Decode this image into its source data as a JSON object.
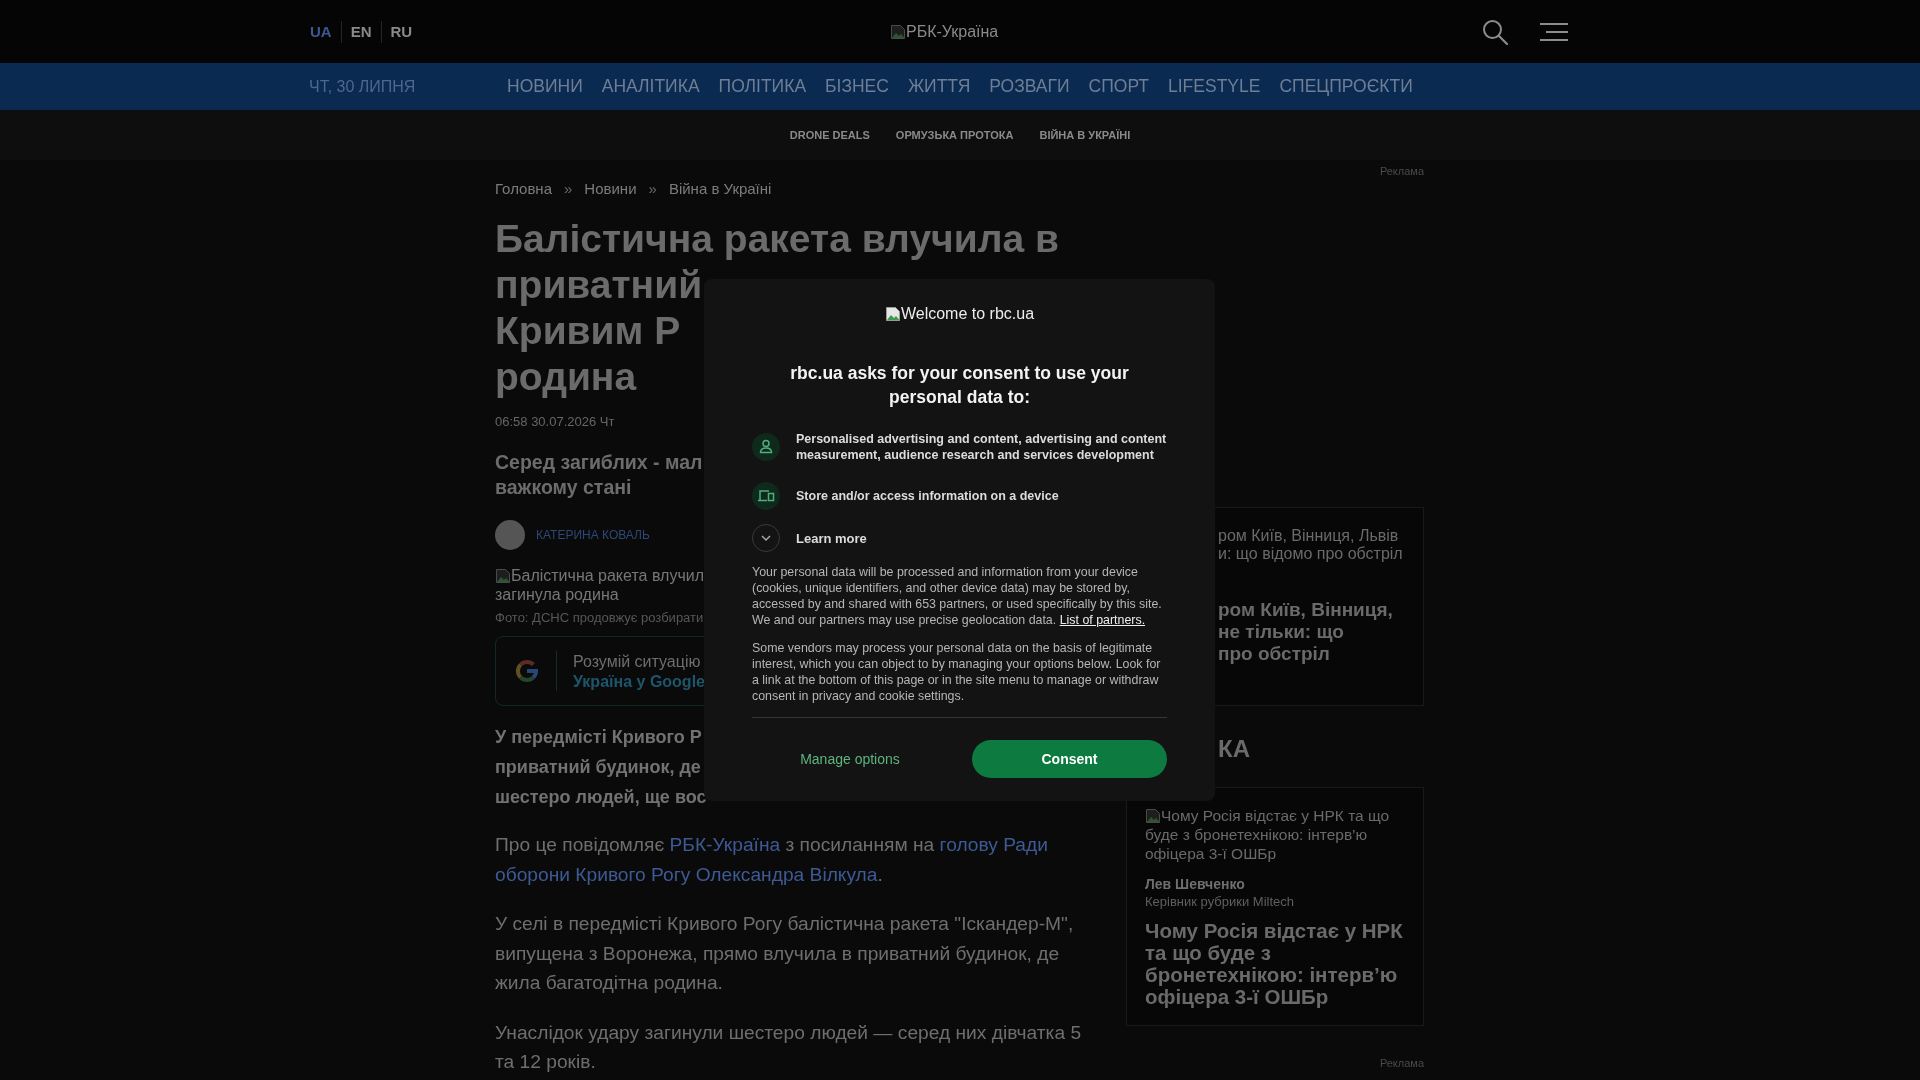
{
  "header": {
    "languages": [
      {
        "label": "UA",
        "selected": true
      },
      {
        "label": "EN",
        "selected": false
      },
      {
        "label": "RU",
        "selected": false
      }
    ],
    "logo_alt": "РБК-Україна"
  },
  "nav": {
    "date": "ЧТ, 30 ЛИПНЯ",
    "items": [
      "НОВИНИ",
      "АНАЛІТИКА",
      "ПОЛІТИКА",
      "БІЗНЕС",
      "ЖИТТЯ",
      "РОЗВАГИ",
      "СПОРТ",
      "LIFESTYLE",
      "СПЕЦПРОЄКТИ"
    ]
  },
  "tags": [
    "DRONE DEALS",
    "ОРМУЗЬКА ПРОТОКА",
    "ВІЙНА В УКРАЇНІ"
  ],
  "article": {
    "breadcrumbs": [
      {
        "kind": "link",
        "label": "Головна"
      },
      {
        "kind": "separator",
        "label": "»"
      },
      {
        "kind": "link",
        "label": "Новини"
      },
      {
        "kind": "separator",
        "label": "»"
      },
      {
        "kind": "link",
        "label": "Війна в Україні"
      }
    ],
    "title_lines": [
      "Балістична ракета влучила в",
      "приватний",
      "Кривим Р",
      "родина"
    ],
    "published": "06:58 30.07.2026 Чт",
    "lead_lines": [
      "Серед загиблих - мал",
      "важкому стані"
    ],
    "author": "КАТЕРИНА КОВАЛЬ",
    "image_alt_lines": [
      "Балістична ракета влучил",
      "загинула родина"
    ],
    "photo_caption": "Фото: ДСНС продовжує розбирати",
    "promo": {
      "text": "Розумій ситуацію",
      "link": "Україна у Google"
    },
    "intro_lines": [
      "У передмісті Кривого Р",
      "приватний будинок, де",
      "шестеро людей, ще вос"
    ],
    "paragraphs": [
      [
        {
          "kind": "text",
          "text": "Про це повідомляє "
        },
        {
          "kind": "link",
          "text": "РБК-Україна"
        },
        {
          "kind": "text",
          "text": " з посиланням на "
        },
        {
          "kind": "link",
          "text": "голову Ради"
        },
        {
          "kind": "link",
          "text": "оборони Кривого Рогу Олександра Вілкула"
        },
        {
          "kind": "text",
          "text": "."
        }
      ],
      [
        {
          "kind": "text",
          "text": "У селі в передмісті Кривого Рогу балістична ракета \"Іскандер-М\", випущена з Воронежа, прямо влучила в приватний будинок, де жила багатодітна родина."
        }
      ],
      [
        {
          "kind": "text",
          "text": "Унаслідок удару загинули шестеро людей — серед них дівчатка 5 та 12 років."
        }
      ]
    ]
  },
  "sidebar": {
    "ad_label_top": "Реклама",
    "card": {
      "image_alt_lines": [
        "ром Київ, Вінниця, Львів",
        "и: що відомо про обстріл"
      ],
      "title_lines": [
        "ром Київ, Вінниця,",
        "не тільки: що",
        "про обстріл"
      ]
    },
    "section_heading": "КА",
    "feature": {
      "image_alt_lines": [
        "Чому Росія відстає у НРК та що",
        "буде з бронетехнікою: інтерв’ю",
        "офіцера 3-ї ОШБр"
      ],
      "author": "Лев Шевченко",
      "role": "Керівник рубрики Miltech",
      "title": "Чому Росія відстає у НРК та що буде з бронетехнікою: інтерв’ю офіцера 3-ї ОШБр"
    },
    "ad_label_bottom": "Реклама"
  },
  "consent": {
    "welcome_alt": "Welcome to rbc.ua",
    "heading": "rbc.ua asks for your consent to use your personal data to:",
    "purposes": [
      {
        "kind": "person",
        "text": "Personalised advertising and content, advertising and content measurement, audience research and services development"
      },
      {
        "kind": "device",
        "text": "Store and/or access information on a device"
      }
    ],
    "learn_more": {
      "label": "Learn more",
      "expanded": false
    },
    "paragraphs": [
      {
        "text": "Your personal data will be processed and information from your device (cookies, unique identifiers, and other device data) may be stored by, accessed by and shared with 653 partners, or used specifically by this site. We and our partners may use precise geolocation data.",
        "link": "List of partners."
      },
      {
        "text": "Some vendors may process your personal data on the basis of legitimate interest, which you can object to by managing your options below. Look for a link at the bottom of this page or in the site menu to manage or withdraw consent in privacy and cookie settings."
      }
    ],
    "buttons": [
      {
        "kind": "secondary",
        "label": "Manage options"
      },
      {
        "kind": "primary",
        "label": "Consent"
      }
    ]
  }
}
